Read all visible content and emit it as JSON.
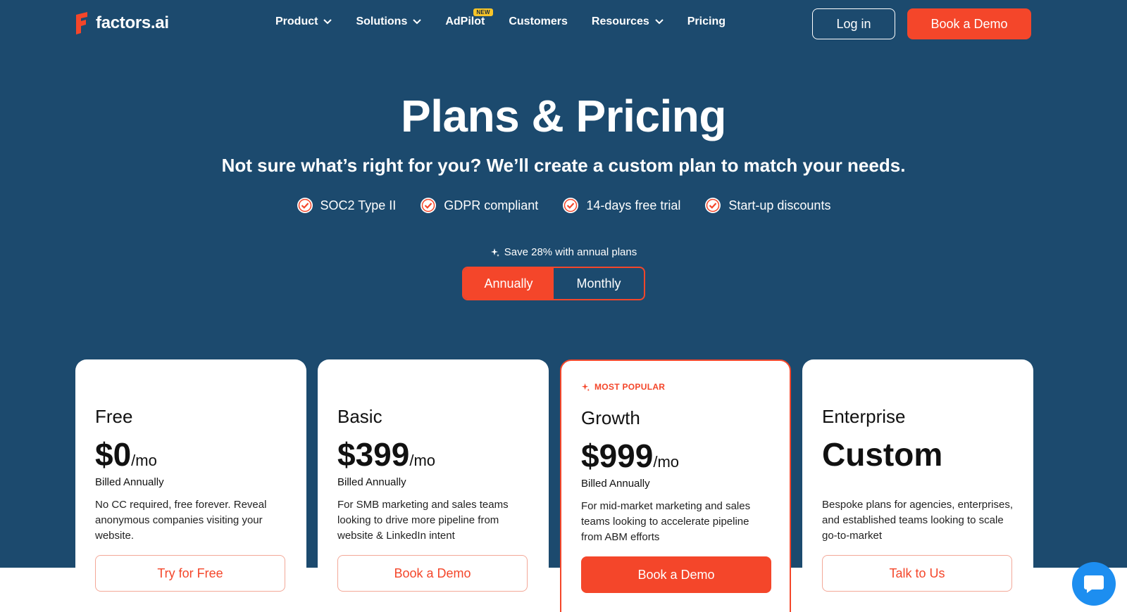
{
  "brand": {
    "name": "factors.ai",
    "accent": "#f4462a",
    "hero_bg": "#1c4a6e"
  },
  "nav": {
    "items": [
      {
        "label": "Product",
        "dropdown": true
      },
      {
        "label": "Solutions",
        "dropdown": true
      },
      {
        "label": "AdPilot",
        "dropdown": false,
        "badge": "NEW"
      },
      {
        "label": "Customers",
        "dropdown": false
      },
      {
        "label": "Resources",
        "dropdown": true
      },
      {
        "label": "Pricing",
        "dropdown": false
      }
    ],
    "login_label": "Log in",
    "demo_label": "Book a Demo"
  },
  "hero": {
    "title": "Plans & Pricing",
    "subtitle": "Not sure what’s right for you? We’ll create a custom plan to match your needs.",
    "badges": [
      "SOC2 Type II",
      "GDPR compliant",
      "14-days free trial",
      "Start-up discounts"
    ],
    "save_note": "Save 28% with annual plans",
    "toggle": {
      "options": [
        "Annually",
        "Monthly"
      ],
      "selected": "Annually"
    }
  },
  "plans": [
    {
      "name": "Free",
      "price": "$0",
      "unit": "/mo",
      "billed": "Billed Annually",
      "desc": "No CC required, free forever. Reveal anonymous companies visiting your website.",
      "cta": "Try for Free",
      "popular": false
    },
    {
      "name": "Basic",
      "price": "$399",
      "unit": "/mo",
      "billed": "Billed Annually",
      "desc": "For SMB marketing and sales teams looking to drive more pipeline from website & LinkedIn intent",
      "cta": "Book a Demo",
      "popular": false
    },
    {
      "name": "Growth",
      "price": "$999",
      "unit": "/mo",
      "billed": "Billed Annually",
      "desc": "For mid-market marketing and sales teams looking to accelerate pipeline from ABM efforts",
      "cta": "Book a Demo",
      "popular": true,
      "popular_label": "MOST POPULAR"
    },
    {
      "name": "Enterprise",
      "price": "Custom",
      "unit": "",
      "billed": "",
      "desc": "Bespoke plans for agencies, enterprises, and established teams looking to scale go-to-market",
      "cta": "Talk to Us",
      "popular": false
    }
  ],
  "icons": {
    "badge": "check-badge-icon",
    "chat": "chat-bubble-icon",
    "sparkle": "sparkle-icon",
    "chevron": "chevron-down-icon"
  }
}
